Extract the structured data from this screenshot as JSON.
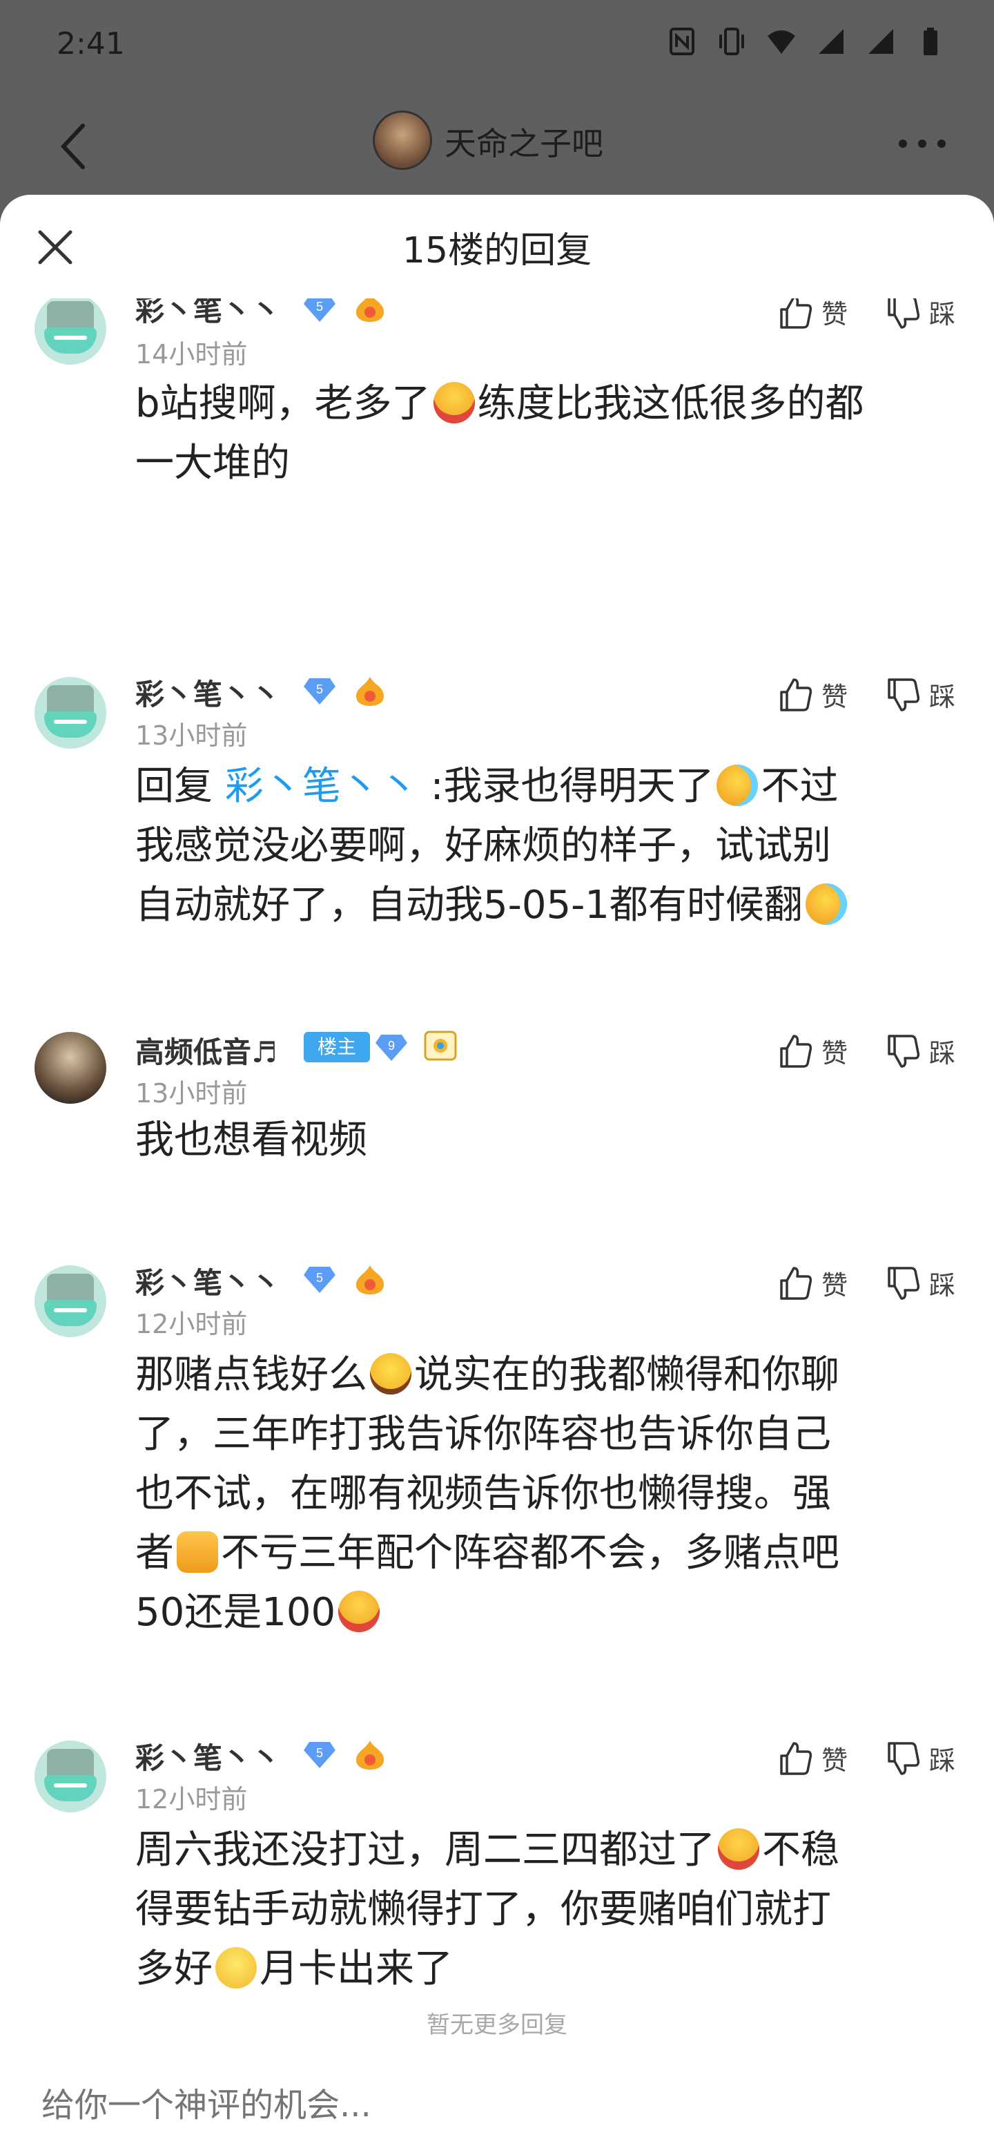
{
  "status_bar": {
    "time": "2:41"
  },
  "nav": {
    "forum_title": "天命之子吧"
  },
  "sheet": {
    "title": "15楼的回复"
  },
  "actions": {
    "like_label": "赞",
    "dislike_label": "踩"
  },
  "replies": [
    {
      "user": "彩丶笔丶丶",
      "level": "5",
      "time": "14小时前",
      "line1": "b站搜啊，老多了",
      "line1b": "练度比我这低很多的都",
      "line2": "一大堆的"
    },
    {
      "user": "彩丶笔丶丶",
      "level": "5",
      "time": "13小时前",
      "prefix": "回复 ",
      "mention": "彩丶笔丶丶",
      "line1": " :我录也得明天了",
      "line1b": "不过",
      "line2": "我感觉没必要啊，好麻烦的样子，试试别",
      "line3": "自动就好了，自动我5-05-1都有时候翻"
    },
    {
      "user": "高频低音♬",
      "host_tag": "楼主",
      "level": "9",
      "time": "13小时前",
      "line1": "我也想看视频"
    },
    {
      "user": "彩丶笔丶丶",
      "level": "5",
      "time": "12小时前",
      "line1": "那赌点钱好么",
      "line1b": "说实在的我都懒得和你聊",
      "line2": "了，三年咋打我告诉你阵容也告诉你自己",
      "line3": "也不试，在哪有视频告诉你也懒得搜。强",
      "line4a": "者",
      "line4b": "不亏三年配个阵容都不会，多赌点吧",
      "line5": "50还是100"
    },
    {
      "user": "彩丶笔丶丶",
      "level": "5",
      "time": "12小时前",
      "line1": "周六我还没打过，周二三四都过了",
      "line1b": "不稳",
      "line2": "得要钻手动就懒得打了，你要赌咱们就打",
      "line3a": "多好",
      "line3b": "月卡出来了"
    }
  ],
  "footer": {
    "no_more": "暂无更多回复",
    "input_placeholder": "给你一个神评的机会..."
  },
  "colors": {
    "mention": "#1e9bef",
    "host_tag": "#3fa7f0",
    "diamond": "#5b9df5",
    "dim_overlay": "#5f5f5f"
  }
}
